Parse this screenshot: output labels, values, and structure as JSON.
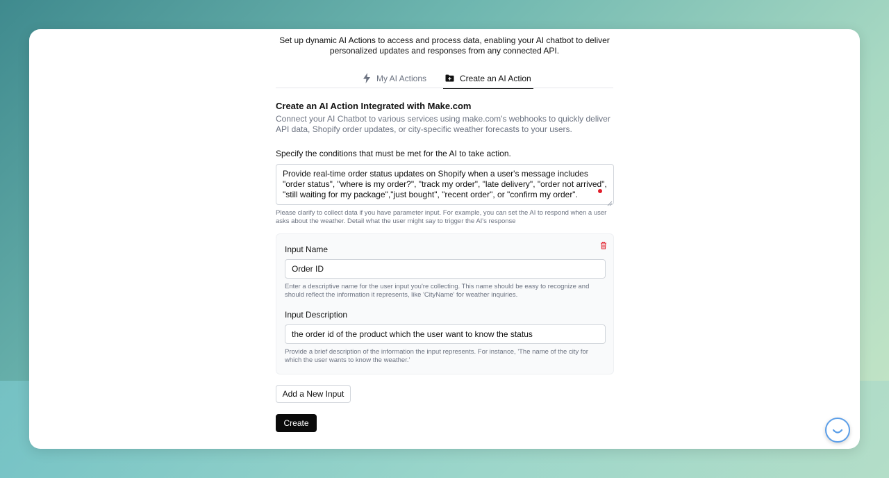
{
  "intro": {
    "line1": "Set up dynamic AI Actions to access and process data, enabling your AI chatbot to deliver",
    "line2": "personalized updates and responses from any connected API."
  },
  "tabs": [
    {
      "label": "My AI Actions",
      "icon": "lightning-icon",
      "active": false
    },
    {
      "label": "Create an AI Action",
      "icon": "folder-plus-icon",
      "active": true
    }
  ],
  "section": {
    "title": "Create an AI Action Integrated with Make.com",
    "description": "Connect your AI Chatbot to various services using make.com's webhooks to quickly deliver API data, Shopify order updates, or city-specific weather forecasts to your users."
  },
  "conditions": {
    "label": "Specify the conditions that must be met for the AI to take action.",
    "value": "Provide real-time order status updates on Shopify when a user's message includes \"order status\", \"where is my order?\", \"track my order\", \"late delivery\", \"order not arrived\", \"still waiting for my package\",\"just bought\", \"recent order\", or \"confirm my order\".",
    "hint": "Please clarify to collect data if you have parameter input. For example, you can set the AI to respond when a user asks about the weather. Detail what the user might say to trigger the AI's response"
  },
  "input": {
    "name_label": "Input Name",
    "name_value": "Order ID",
    "name_hint": "Enter a descriptive name for the user input you're collecting. This name should be easy to recognize and should reflect the information it represents, like 'CityName' for weather inquiries.",
    "desc_label": "Input Description",
    "desc_value": "the order id of the product which the user want to know the status",
    "desc_hint": "Provide a brief description of the information the input represents. For instance, 'The name of the city for which the user wants to know the weather.'"
  },
  "buttons": {
    "add_input": "Add a New Input",
    "create": "Create"
  },
  "colors": {
    "accent": "#0a0a0a",
    "muted_text": "#6b7280",
    "danger": "#e11d2a",
    "launcher_border": "#5b9ee8"
  }
}
